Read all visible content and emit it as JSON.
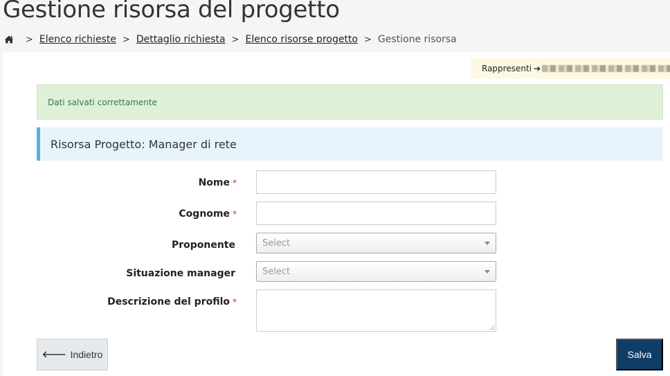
{
  "page": {
    "title": "Gestione risorsa del progetto"
  },
  "breadcrumb": {
    "home_icon": "home-icon",
    "separator": ">",
    "items": [
      {
        "label": "Elenco richieste",
        "link": true
      },
      {
        "label": "Dettaglio richiesta",
        "link": true
      },
      {
        "label": "Elenco risorse progetto",
        "link": true
      },
      {
        "label": "Gestione risorsa",
        "link": false
      }
    ]
  },
  "represent": {
    "label": "Rappresenti",
    "arrow_icon": "arrow-right-icon",
    "value_redacted": true
  },
  "alert": {
    "message": "Dati salvati correttamente",
    "color": "#3c763d",
    "background": "#dff0d8"
  },
  "section": {
    "title": "Risorsa Progetto: Manager di rete",
    "accent": "#5aaedc"
  },
  "form": {
    "fields": [
      {
        "label": "Nome",
        "required": true,
        "type": "text",
        "value": ""
      },
      {
        "label": "Cognome",
        "required": true,
        "type": "text",
        "value": ""
      },
      {
        "label": "Proponente",
        "required": false,
        "type": "select",
        "value": "Select"
      },
      {
        "label": "Situazione manager",
        "required": false,
        "type": "select",
        "value": "Select"
      },
      {
        "label": "Descrizione del profilo",
        "required": true,
        "type": "textarea",
        "value": ""
      }
    ],
    "required_mark": "*"
  },
  "actions": {
    "back_label": "Indietro",
    "back_icon": "arrow-left-icon",
    "save_label": "Salva",
    "save_color": "#0e3d65"
  }
}
